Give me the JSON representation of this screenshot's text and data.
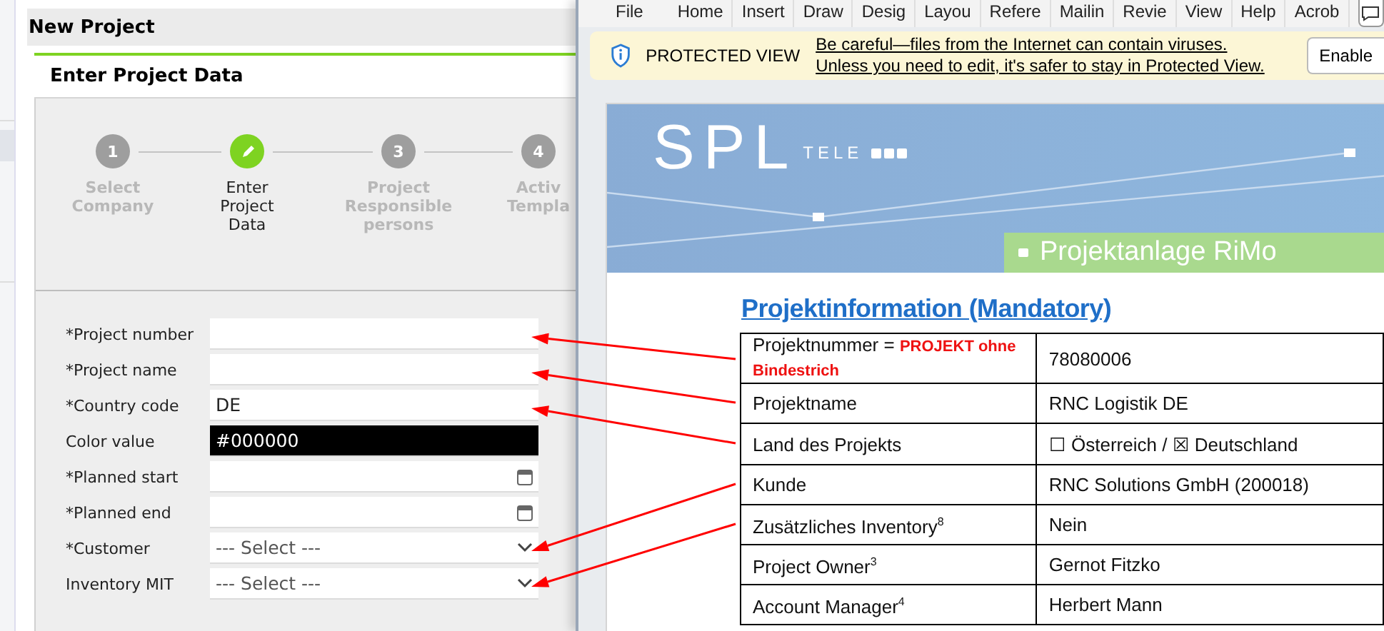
{
  "app": {
    "title": "New Project",
    "card_title": "Enter Project Data",
    "steps": [
      {
        "number": "1",
        "label": "Select Company",
        "selected": false
      },
      {
        "label": "Enter Project Data",
        "selected": true
      },
      {
        "number": "3",
        "label": "Project Responsible persons",
        "selected": false
      },
      {
        "number": "4",
        "label": "Activ Templa",
        "selected": false
      }
    ],
    "fields": [
      {
        "label": "*Project number",
        "kind": "text"
      },
      {
        "label": "*Project name",
        "kind": "text"
      },
      {
        "label": "*Country code",
        "kind": "text",
        "value": "DE"
      },
      {
        "label": "Color value",
        "kind": "color",
        "value": "#000000"
      },
      {
        "label": "*Planned start",
        "kind": "date"
      },
      {
        "label": "*Planned end",
        "kind": "date"
      },
      {
        "label": "*Customer",
        "kind": "select",
        "value": "--- Select ---"
      },
      {
        "label": "Inventory MIT",
        "kind": "select",
        "value": "--- Select ---"
      }
    ]
  },
  "word": {
    "ribbon_tabs": [
      "File",
      "Home",
      "Insert",
      "Draw",
      "Desig",
      "Layou",
      "Refere",
      "Mailin",
      "Revie",
      "View",
      "Help",
      "Acrob"
    ],
    "protected_view": {
      "title": "PROTECTED VIEW",
      "message": "Be careful—files from the Internet can contain viruses. Unless you need to edit, it's safer to stay in Protected View.",
      "button": "Enable"
    },
    "document": {
      "logo": "SPL",
      "logo_suffix": "TELE",
      "banner": "Projektanlage RiMo",
      "heading": "Projektinformation (Mandatory)",
      "rows": [
        {
          "label": "Projektnummer = **PROJEKT ohne Bindestrich**",
          "value": "78080006"
        },
        {
          "label": "Projektname",
          "value": "RNC Logistik DE"
        },
        {
          "label": "Land des Projekts",
          "value": "☐ Österreich / ☒ Deutschland"
        },
        {
          "label": "Kunde",
          "value": "RNC Solutions GmbH (200018)"
        },
        {
          "label": "Zusätzliches Inventory$^{8}$",
          "value": "Nein"
        },
        {
          "label": "Project Owner$^{3}$",
          "value": "Gernot Fitzko"
        },
        {
          "label": "Account Manager$^{4}$",
          "value": "Herbert Mann"
        }
      ]
    }
  }
}
